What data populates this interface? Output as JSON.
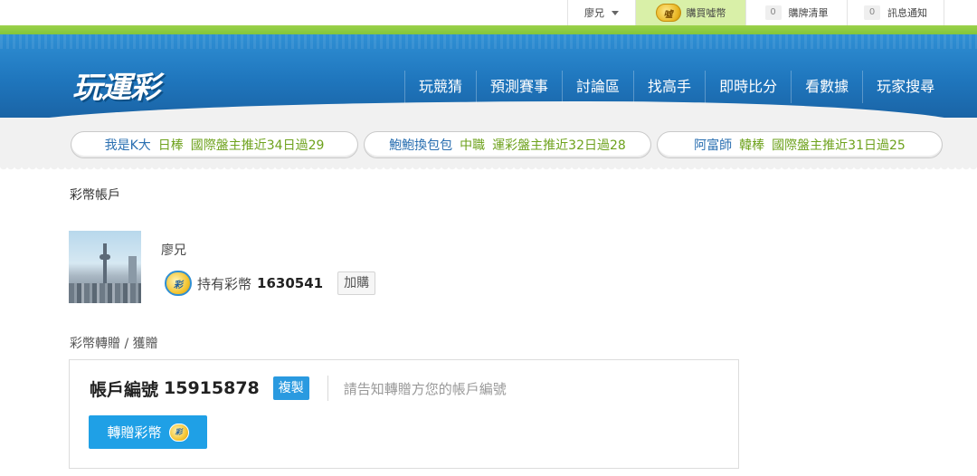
{
  "topbar": {
    "user_name": "廖兄",
    "buy_label": "購買噓幣",
    "buy_icon_text": "噓",
    "cart_count": "0",
    "cart_label": "購牌清單",
    "msg_count": "0",
    "msg_label": "訊息通知"
  },
  "header": {
    "logo_text": "玩運彩",
    "nav": [
      "玩競猜",
      "預測賽事",
      "討論區",
      "找高手",
      "即時比分",
      "看數據",
      "玩家搜尋"
    ]
  },
  "ticker": [
    {
      "name": "我是K大",
      "league": "日棒",
      "record": "國際盤主推近34日過29"
    },
    {
      "name": "鮑鮑換包包",
      "league": "中職",
      "record": "運彩盤主推近32日過28"
    },
    {
      "name": "阿富師",
      "league": "韓棒",
      "record": "國際盤主推近31日過25"
    }
  ],
  "account": {
    "section_title": "彩幣帳戶",
    "username": "廖兄",
    "coin_icon_text": "彩",
    "hold_label": "持有彩幣",
    "hold_value": "1630541",
    "add_label": "加購"
  },
  "transfer": {
    "section_title": "彩幣轉贈 / 獲贈",
    "acct_label": "帳戶編號",
    "acct_number": "15915878",
    "copy_label": "複製",
    "hint": "請告知轉贈方您的帳戶編號",
    "give_label": "轉贈彩幣"
  },
  "colors": {
    "brand_blue": "#1f76bd",
    "brand_green": "#6ab82c",
    "button_blue": "#1fa0e6"
  }
}
